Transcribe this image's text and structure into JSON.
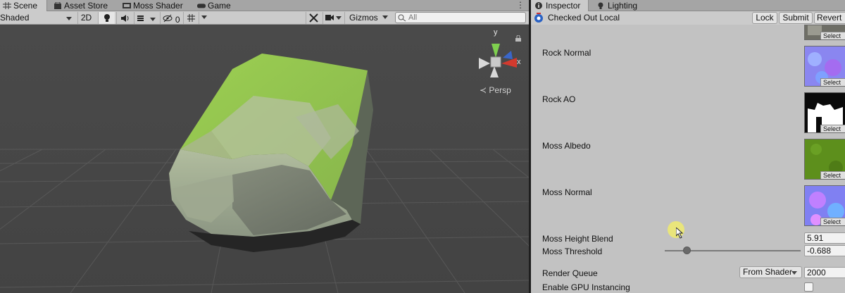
{
  "scene": {
    "tabs": [
      {
        "label": "Scene",
        "icon": "grid-icon"
      },
      {
        "label": "Asset Store",
        "icon": "store-icon"
      },
      {
        "label": "Moss Shader",
        "icon": "shader-icon"
      },
      {
        "label": "Game",
        "icon": "gamepad-icon"
      }
    ],
    "tab_more": "⋮",
    "toolbar": {
      "shading_mode": "Shaded",
      "mode_2d": "2D",
      "hidden_count": "0",
      "gizmos": "Gizmos",
      "search_placeholder": "All"
    },
    "projection": "Persp",
    "gizmo_axes": {
      "y": "y",
      "x": "x"
    }
  },
  "inspector": {
    "tabs": [
      {
        "label": "Inspector",
        "icon": "info-icon"
      },
      {
        "label": "Lighting",
        "icon": "bulb-icon"
      }
    ],
    "vc_status": "Checked Out Local",
    "buttons": {
      "lock": "Lock",
      "submit": "Submit",
      "revert": "Revert"
    },
    "textures": [
      {
        "label": "Rock Normal",
        "select": "Select"
      },
      {
        "label": "Rock AO",
        "select": "Select"
      },
      {
        "label": "Moss Albedo",
        "select": "Select"
      },
      {
        "label": "Moss Normal",
        "select": "Select"
      }
    ],
    "top_texture_select": "Select",
    "moss_height_blend": {
      "label": "Moss Height Blend",
      "value": "5.91"
    },
    "moss_threshold": {
      "label": "Moss Threshold",
      "value": "-0.688"
    },
    "render_queue": {
      "label": "Render Queue",
      "mode": "From Shader",
      "value": "2000"
    },
    "gpu_instancing": {
      "label": "Enable GPU Instancing",
      "checked": false
    }
  }
}
